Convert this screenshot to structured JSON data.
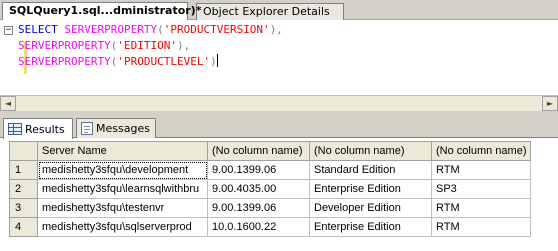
{
  "doc_tabs": {
    "active_label": "SQLQuery1.sql...dministrator)*",
    "inactive_label": "Object Explorer Details"
  },
  "editor": {
    "collapse_glyph": "−",
    "line1": {
      "select": "SELECT",
      "fn": "SERVERPROPERTY",
      "open": "(",
      "arg": "'PRODUCTVERSION'",
      "close": "),",
      "trail": ""
    },
    "line2": {
      "fn": "SERVERPROPERTY",
      "open": "(",
      "arg": "'EDITION'",
      "close": "),",
      "trail": ""
    },
    "line3": {
      "fn": "SERVERPROPERTY",
      "open": "(",
      "arg": "'PRODUCTLEVEL'",
      "close": ")",
      "trail": ""
    }
  },
  "scrollbar": {
    "left_arrow": "◄",
    "right_arrow": "►"
  },
  "results_tabs": {
    "results_label": "Results",
    "messages_label": "Messages"
  },
  "grid": {
    "columns": [
      "Server Name",
      "(No column name)",
      "(No column name)",
      "(No column name)"
    ],
    "rows": [
      {
        "num": "1",
        "cells": [
          "medishetty3sfqu\\development",
          "9.00.1399.06",
          "Standard Edition",
          "RTM"
        ]
      },
      {
        "num": "2",
        "cells": [
          "medishetty3sfqu\\learnsqlwithbru",
          "9.00.4035.00",
          "Enterprise Edition",
          "SP3"
        ]
      },
      {
        "num": "3",
        "cells": [
          "medishetty3sfqu\\testenvr",
          "9.00.1399.06",
          "Developer Edition",
          "RTM"
        ]
      },
      {
        "num": "4",
        "cells": [
          "medishetty3sfqu\\sqlserverprod",
          "10.0.1600.22",
          "Enterprise Edition",
          "RTM"
        ]
      }
    ]
  },
  "icons": {
    "results_tab": "grid-icon",
    "messages_tab": "message-icon",
    "collapse": "collapse-icon"
  },
  "colors": {
    "keyword": "#0000ff",
    "function": "#ff00ff",
    "string": "#ff0000",
    "chrome": "#d4d0c8"
  }
}
